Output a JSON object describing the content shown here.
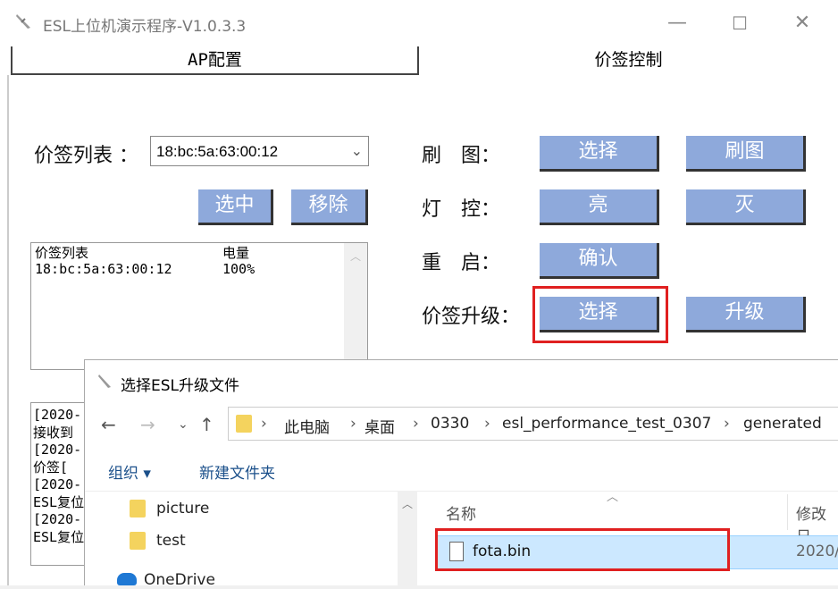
{
  "window": {
    "title": "ESL上位机演示程序-V1.0.3.3",
    "minimize": "—",
    "maximize": "☐",
    "close": "✕"
  },
  "tabs": [
    {
      "label": "AP配置"
    },
    {
      "label": "价签控制"
    }
  ],
  "left": {
    "list_label": "价签列表 ：",
    "combo_value": "18:bc:5a:63:00:12",
    "select_btn": "选中",
    "remove_btn": "移除",
    "list_header": [
      "价签列表",
      "电量"
    ],
    "list_rows": [
      [
        "18:bc:5a:63:00:12",
        "100%"
      ]
    ],
    "log_lines": [
      "[2020-",
      "接收到",
      "[2020-",
      "价签[",
      "[2020-",
      "ESL复位",
      "[2020-",
      "ESL复位"
    ]
  },
  "right": {
    "rows": [
      {
        "label": "刷　图：",
        "btn1": "选择",
        "btn2": "刷图"
      },
      {
        "label": "灯　控：",
        "btn1": "亮",
        "btn2": "灭"
      },
      {
        "label": "重　启：",
        "btn1": "确认"
      },
      {
        "label": "价签升级：",
        "btn1": "选择",
        "btn2": "升级"
      }
    ]
  },
  "dialog": {
    "title": "选择ESL升级文件",
    "path": [
      "此电脑",
      "桌面",
      "0330",
      "esl_performance_test_0307",
      "generated"
    ],
    "organize": "组织 ▾",
    "new_folder": "新建文件夹",
    "tree": [
      "picture",
      "test",
      "OneDrive"
    ],
    "columns": [
      "名称",
      "修改日"
    ],
    "file": {
      "name": "fota.bin",
      "date": "2020/"
    }
  },
  "colors": {
    "button": "#8ea9db",
    "highlight": "#e02020",
    "selection": "#cce8ff"
  }
}
